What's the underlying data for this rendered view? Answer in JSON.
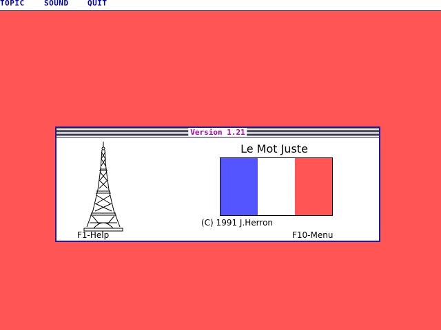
{
  "menu": {
    "items": [
      {
        "label": "TOPIC"
      },
      {
        "label": "SOUND"
      },
      {
        "label": "QUIT"
      }
    ]
  },
  "dialog": {
    "version": "Version 1.21",
    "title": "Le Mot Juste",
    "copyright": "(C) 1991 J.Herron",
    "help_label": "F1-Help",
    "menu_label": "F10-Menu"
  },
  "colors": {
    "background": "#ff5555",
    "flag_blue": "#5555ff",
    "flag_white": "#ffffff",
    "flag_red": "#ff5555",
    "accent": "#a800a8",
    "menu_text": "#0000a8"
  },
  "icons": {
    "eiffel_tower": "eiffel-tower-icon",
    "flag": "french-flag"
  }
}
